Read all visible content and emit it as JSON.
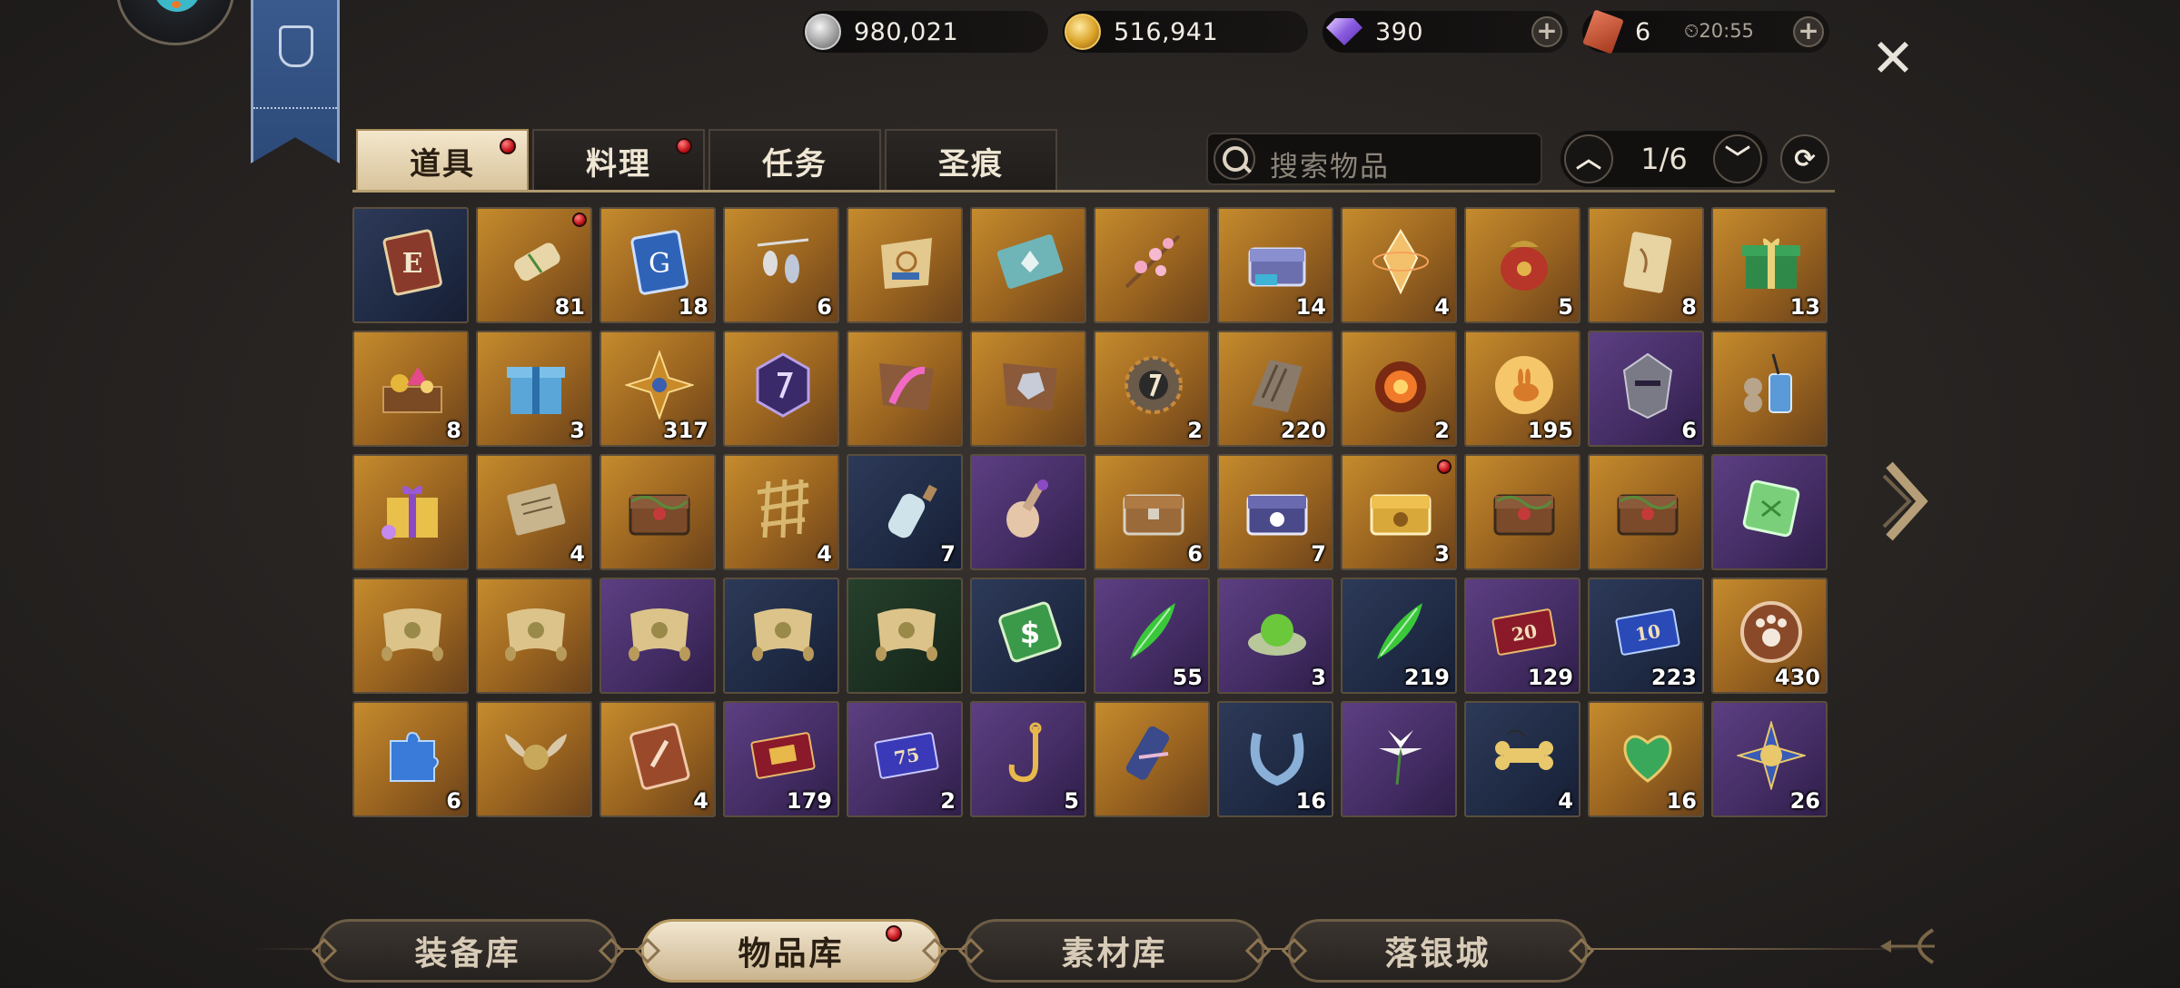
{
  "currency": {
    "silver": "980,021",
    "gold": "516,941",
    "gems": "390",
    "tickets": "6",
    "ticket_timer": "20:55"
  },
  "tabs": [
    {
      "label": "道具",
      "active": true,
      "badge": true
    },
    {
      "label": "料理",
      "active": false,
      "badge": true
    },
    {
      "label": "任务",
      "active": false,
      "badge": false
    },
    {
      "label": "圣痕",
      "active": false,
      "badge": false
    }
  ],
  "search": {
    "placeholder": "搜索物品"
  },
  "pager": {
    "text": "1/6"
  },
  "colors": {
    "rarity_gold": "#b07826",
    "rarity_purple": "#4e3572",
    "rarity_blue": "#24304c",
    "rarity_green": "#1f3424",
    "badge_red": "#c4141a"
  },
  "items": [
    [
      {
        "rarity": "blue",
        "icon": "e-card-icon",
        "qty": "",
        "badge": false
      },
      {
        "rarity": "gold",
        "icon": "scroll-icon",
        "qty": "81",
        "badge": true
      },
      {
        "rarity": "gold",
        "icon": "g-card-icon",
        "qty": "18",
        "badge": false
      },
      {
        "rarity": "gold",
        "icon": "lanterns-icon",
        "qty": "6",
        "badge": false
      },
      {
        "rarity": "gold",
        "icon": "treasure-map-icon",
        "qty": "",
        "badge": false
      },
      {
        "rarity": "gold",
        "icon": "deer-card-icon",
        "qty": "",
        "badge": false
      },
      {
        "rarity": "gold",
        "icon": "blossom-branch-icon",
        "qty": "",
        "badge": false
      },
      {
        "rarity": "gold",
        "icon": "silver-chest-icon",
        "qty": "14",
        "badge": false
      },
      {
        "rarity": "gold",
        "icon": "crystal-icon",
        "qty": "4",
        "badge": false
      },
      {
        "rarity": "gold",
        "icon": "lucky-bag-icon",
        "qty": "5",
        "badge": false
      },
      {
        "rarity": "gold",
        "icon": "parchment-icon",
        "qty": "8",
        "badge": false
      },
      {
        "rarity": "gold",
        "icon": "green-gift-icon",
        "qty": "13",
        "badge": false
      }
    ],
    [
      {
        "rarity": "gold",
        "icon": "treasure-tray-icon",
        "qty": "8",
        "badge": false
      },
      {
        "rarity": "gold",
        "icon": "blue-gift-icon",
        "qty": "3",
        "badge": false
      },
      {
        "rarity": "gold",
        "icon": "star-emblem-icon",
        "qty": "317",
        "badge": false
      },
      {
        "rarity": "gold",
        "icon": "purple-medal-icon",
        "qty": "",
        "badge": false
      },
      {
        "rarity": "gold",
        "icon": "pink-feather-icon",
        "qty": "",
        "badge": false
      },
      {
        "rarity": "gold",
        "icon": "ore-hide-icon",
        "qty": "",
        "badge": false
      },
      {
        "rarity": "gold",
        "icon": "gear-medal-icon",
        "qty": "2",
        "badge": false
      },
      {
        "rarity": "gold",
        "icon": "wood-bark-icon",
        "qty": "220",
        "badge": false
      },
      {
        "rarity": "gold",
        "icon": "fire-orb-icon",
        "qty": "2",
        "badge": false
      },
      {
        "rarity": "gold",
        "icon": "rabbit-moon-icon",
        "qty": "195",
        "badge": false
      },
      {
        "rarity": "purple",
        "icon": "warrior-head-icon",
        "qty": "6",
        "badge": false
      },
      {
        "rarity": "gold",
        "icon": "pipes-and-jar-icon",
        "qty": "",
        "badge": false
      }
    ],
    [
      {
        "rarity": "gold",
        "icon": "purple-gift-icon",
        "qty": "",
        "badge": false
      },
      {
        "rarity": "gold",
        "icon": "letter-icon",
        "qty": "4",
        "badge": false
      },
      {
        "rarity": "gold",
        "icon": "vine-chest-icon",
        "qty": "",
        "badge": false
      },
      {
        "rarity": "gold",
        "icon": "lattice-icon",
        "qty": "4",
        "badge": false
      },
      {
        "rarity": "blue",
        "icon": "message-bottle-icon",
        "qty": "7",
        "badge": false
      },
      {
        "rarity": "purple",
        "icon": "potion-bottle-icon",
        "qty": "",
        "badge": false
      },
      {
        "rarity": "gold",
        "icon": "wooden-chest-icon",
        "qty": "6",
        "badge": false
      },
      {
        "rarity": "gold",
        "icon": "paw-chest-icon",
        "qty": "7",
        "badge": false
      },
      {
        "rarity": "gold",
        "icon": "golden-paw-chest-icon",
        "qty": "3",
        "badge": true
      },
      {
        "rarity": "gold",
        "icon": "vine-chest-icon",
        "qty": "",
        "badge": false
      },
      {
        "rarity": "gold",
        "icon": "vine-chest-icon",
        "qty": "",
        "badge": false
      },
      {
        "rarity": "purple",
        "icon": "green-gem-icon",
        "qty": "",
        "badge": false
      }
    ],
    [
      {
        "rarity": "gold",
        "icon": "map-scroll-icon",
        "qty": "",
        "badge": false
      },
      {
        "rarity": "gold",
        "icon": "map-scroll-icon",
        "qty": "",
        "badge": false
      },
      {
        "rarity": "purple",
        "icon": "map-scroll-icon",
        "qty": "",
        "badge": false
      },
      {
        "rarity": "blue",
        "icon": "map-scroll-icon",
        "qty": "",
        "badge": false
      },
      {
        "rarity": "green",
        "icon": "map-scroll-icon",
        "qty": "",
        "badge": false
      },
      {
        "rarity": "blue",
        "icon": "dollar-card-icon",
        "qty": "",
        "badge": false
      },
      {
        "rarity": "purple",
        "icon": "green-feather-icon",
        "qty": "55",
        "badge": false
      },
      {
        "rarity": "purple",
        "icon": "green-ball-icon",
        "qty": "3",
        "badge": false
      },
      {
        "rarity": "blue",
        "icon": "green-feather-icon",
        "qty": "219",
        "badge": false
      },
      {
        "rarity": "purple",
        "icon": "red-ticket-icon",
        "qty": "129",
        "badge": false
      },
      {
        "rarity": "blue",
        "icon": "blue-ticket-icon",
        "qty": "223",
        "badge": false
      },
      {
        "rarity": "gold",
        "icon": "paw-badge-icon",
        "qty": "430",
        "badge": false
      }
    ],
    [
      {
        "rarity": "gold",
        "icon": "puzzle-icon",
        "qty": "6",
        "badge": false
      },
      {
        "rarity": "gold",
        "icon": "winged-orb-icon",
        "qty": "",
        "badge": false
      },
      {
        "rarity": "gold",
        "icon": "boot-card-icon",
        "qty": "4",
        "badge": false
      },
      {
        "rarity": "purple",
        "icon": "gold-ticket-icon",
        "qty": "179",
        "badge": false
      },
      {
        "rarity": "purple",
        "icon": "discount-ticket-icon",
        "qty": "2",
        "badge": false
      },
      {
        "rarity": "purple",
        "icon": "fish-hook-icon",
        "qty": "5",
        "badge": false
      },
      {
        "rarity": "gold",
        "icon": "ribbon-scroll-icon",
        "qty": "",
        "badge": false
      },
      {
        "rarity": "blue",
        "icon": "horseshoe-icon",
        "qty": "16",
        "badge": false
      },
      {
        "rarity": "purple",
        "icon": "lily-icon",
        "qty": "",
        "badge": false
      },
      {
        "rarity": "blue",
        "icon": "bone-toy-icon",
        "qty": "4",
        "badge": false
      },
      {
        "rarity": "gold",
        "icon": "green-heart-icon",
        "qty": "16",
        "badge": false
      },
      {
        "rarity": "purple",
        "icon": "cross-medal-icon",
        "qty": "26",
        "badge": false
      }
    ]
  ],
  "ticket_labels": {
    "red": "20",
    "blue": "10",
    "discount": "75"
  },
  "bottom_nav": [
    {
      "label": "装备库",
      "active": false,
      "badge": false
    },
    {
      "label": "物品库",
      "active": true,
      "badge": true
    },
    {
      "label": "素材库",
      "active": false,
      "badge": false
    },
    {
      "label": "落银城",
      "active": false,
      "badge": false
    }
  ]
}
